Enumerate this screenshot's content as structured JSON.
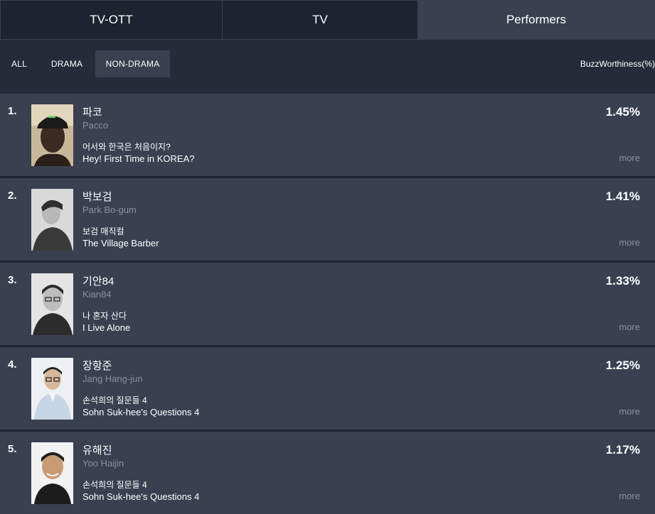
{
  "tabs": [
    {
      "label": "TV-OTT",
      "active": false
    },
    {
      "label": "TV",
      "active": false
    },
    {
      "label": "Performers",
      "active": true
    }
  ],
  "filters": [
    {
      "label": "ALL",
      "active": false
    },
    {
      "label": "DRAMA",
      "active": false
    },
    {
      "label": "NON-DRAMA",
      "active": true
    }
  ],
  "metric_label": "BuzzWorthiness(%)",
  "more_label": "more",
  "rows": [
    {
      "rank": "1.",
      "name_kr": "파코",
      "name_en": "Pacco",
      "show_kr": "어서와 한국은 처음이지?",
      "show_en": "Hey! First Time in KOREA?",
      "score": "1.45%"
    },
    {
      "rank": "2.",
      "name_kr": "박보검",
      "name_en": "Park Bo-gum",
      "show_kr": "보검 매직컬",
      "show_en": "The Village Barber",
      "score": "1.41%"
    },
    {
      "rank": "3.",
      "name_kr": "기안84",
      "name_en": "Kian84",
      "show_kr": "나 혼자 산다",
      "show_en": "I Live Alone",
      "score": "1.33%"
    },
    {
      "rank": "4.",
      "name_kr": "장항준",
      "name_en": "Jang Hang-jun",
      "show_kr": "손석희의 질문들 4",
      "show_en": "Sohn Suk-hee's Questions 4",
      "score": "1.25%"
    },
    {
      "rank": "5.",
      "name_kr": "유해진",
      "name_en": "Yoo Haijin",
      "show_kr": "손석희의 질문들 4",
      "show_en": "Sohn Suk-hee's Questions 4",
      "score": "1.17%"
    }
  ]
}
